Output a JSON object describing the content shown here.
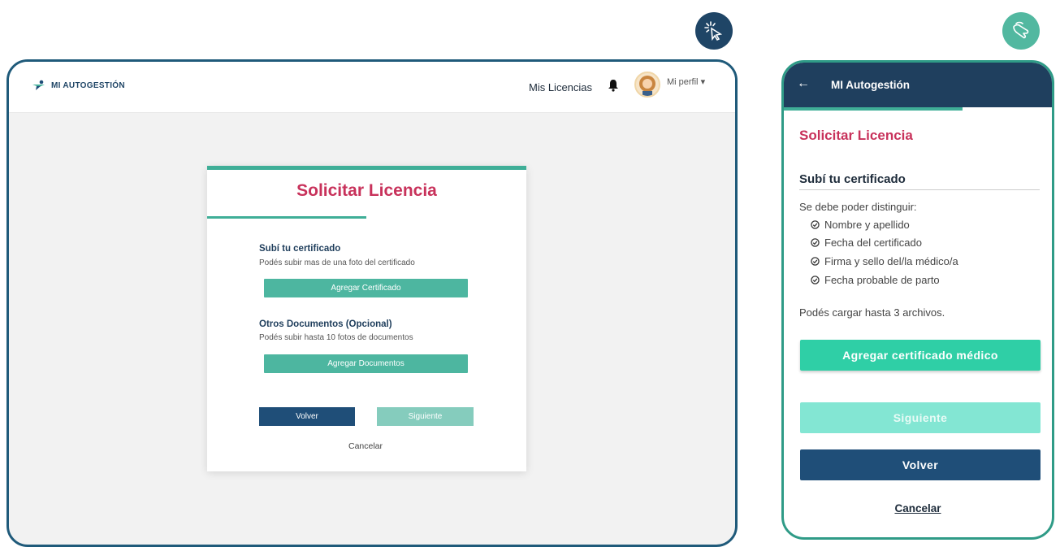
{
  "badges": {
    "click_icon": "cursor-click-icon",
    "touch_icon": "hand-touch-icon"
  },
  "desktop": {
    "header": {
      "logo_text": "MI AUTOGESTIÓN",
      "nav_link": "Mis Licencias",
      "profile_label": "Mi perfil",
      "profile_caret": "▾"
    },
    "card": {
      "title": "Solicitar Licencia",
      "cert_heading": "Subí tu certificado",
      "cert_desc": "Podés subir mas de una foto del certificado",
      "cert_button": "Agregar Certificado",
      "docs_heading": "Otros Documentos (Opcional)",
      "docs_desc": "Podés subir hasta 10 fotos de documentos",
      "docs_button": "Agregar Documentos",
      "back_button": "Volver",
      "next_button": "Siguiente",
      "cancel_link": "Cancelar"
    }
  },
  "mobile": {
    "header_title": "MI Autogestión",
    "back_arrow": "←",
    "title": "Solicitar Licencia",
    "section_title": "Subí tu certificado",
    "instructions": "Se debe poder distinguir:",
    "checklist": [
      "Nombre y apellido",
      "Fecha del certificado",
      "Firma y sello del/la médico/a",
      "Fecha probable de parto"
    ],
    "limit_note": "Podés cargar hasta 3 archivos.",
    "add_button": "Agregar certificado médico",
    "next_button": "Siguiente",
    "back_button": "Volver",
    "cancel_link": "Cancelar"
  },
  "colors": {
    "accent": "#3fae97",
    "title": "#c8325b",
    "navy": "#1f4e78"
  }
}
